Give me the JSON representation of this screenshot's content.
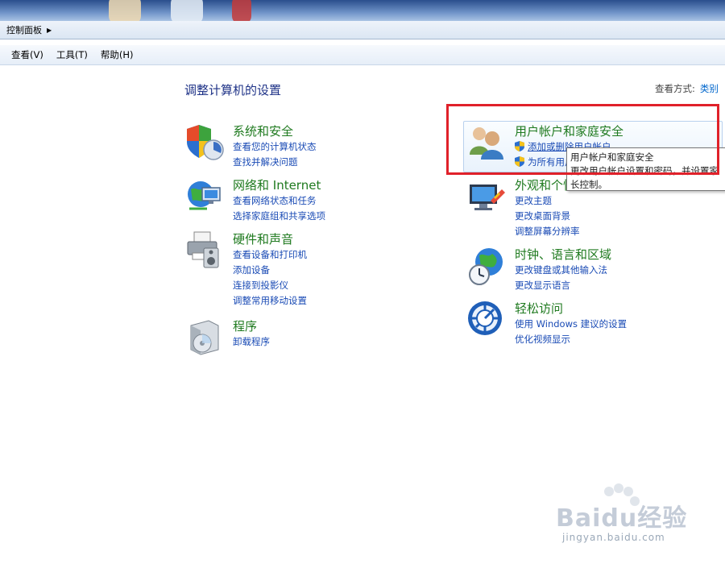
{
  "address": {
    "crumb": "控制面板"
  },
  "menu": [
    "查看(V)",
    "工具(T)",
    "帮助(H)"
  ],
  "heading": "调整计算机的设置",
  "view_by": {
    "label": "查看方式:",
    "value": "类别"
  },
  "categories": [
    {
      "title": "系统和安全",
      "links": [
        "查看您的计算机状态",
        "查找并解决问题"
      ]
    },
    {
      "title": "网络和 Internet",
      "links": [
        "查看网络状态和任务",
        "选择家庭组和共享选项"
      ]
    },
    {
      "title": "硬件和声音",
      "links": [
        "查看设备和打印机",
        "添加设备",
        "连接到投影仪",
        "调整常用移动设置"
      ]
    },
    {
      "title": "程序",
      "links": [
        "卸载程序"
      ]
    },
    {
      "title": "用户帐户和家庭安全",
      "links": [
        "添加或删除用户帐户",
        "为所有用户设置家长控制"
      ]
    },
    {
      "title": "外观和个性化",
      "links": [
        "更改主题",
        "更改桌面背景",
        "调整屏幕分辨率"
      ]
    },
    {
      "title": "时钟、语言和区域",
      "links": [
        "更改键盘或其他输入法",
        "更改显示语言"
      ]
    },
    {
      "title": "轻松访问",
      "links": [
        "使用 Windows 建议的设置",
        "优化视频显示"
      ]
    }
  ],
  "tooltip": {
    "line1": "用户帐户和家庭安全",
    "line2": "更改用户帐户设置和密码，并设置家",
    "line3": "长控制。"
  },
  "watermark": {
    "logo": "Baidu经验",
    "url": "jingyan.baidu.com"
  },
  "colors": {
    "category_title": "#1f7a1f",
    "link": "#1a4bb5",
    "highlight_border": "#e0212a"
  }
}
